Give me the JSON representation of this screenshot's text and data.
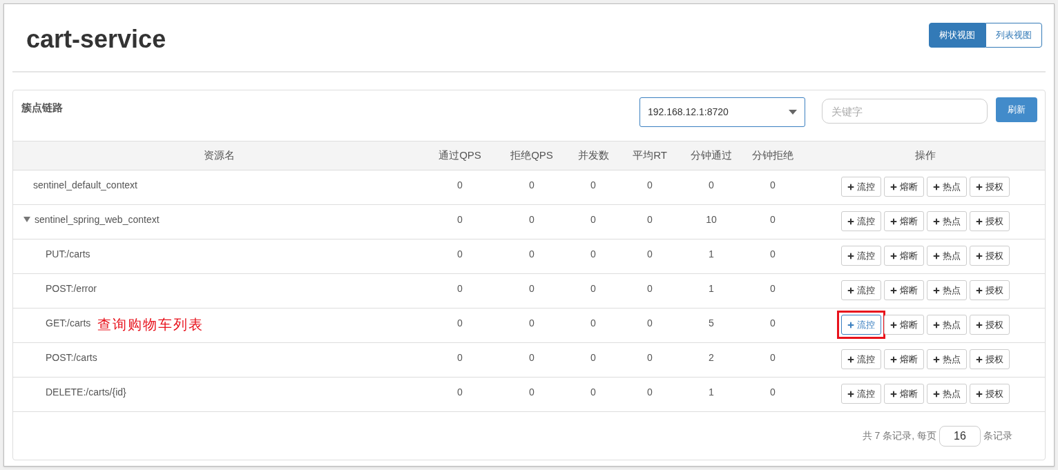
{
  "header": {
    "title": "cart-service",
    "view_toggle": [
      {
        "label": "树状视图",
        "selected": true
      },
      {
        "label": "列表视图",
        "selected": false
      }
    ]
  },
  "panel": {
    "title": "簇点链路",
    "machine_select": {
      "value": "192.168.12.1:8720"
    },
    "search": {
      "placeholder": "关键字"
    },
    "refresh_button": "刷新"
  },
  "table": {
    "columns": [
      "资源名",
      "通过QPS",
      "拒绝QPS",
      "并发数",
      "平均RT",
      "分钟通过",
      "分钟拒绝",
      "操作"
    ],
    "rows": [
      {
        "name": "sentinel_default_context",
        "values": [
          "0",
          "0",
          "0",
          "0",
          "0",
          "0"
        ],
        "actions": [
          {
            "label": "流控",
            "highlighted": false
          },
          {
            "label": "熔断",
            "highlighted": false
          },
          {
            "label": "热点",
            "highlighted": false
          },
          {
            "label": "授权",
            "highlighted": false
          }
        ]
      },
      {
        "name": "sentinel_spring_web_context",
        "expanded": true,
        "values": [
          "0",
          "0",
          "0",
          "0",
          "10",
          "0"
        ],
        "actions": [
          {
            "label": "流控",
            "highlighted": false
          },
          {
            "label": "熔断",
            "highlighted": false
          },
          {
            "label": "热点",
            "highlighted": false
          },
          {
            "label": "授权",
            "highlighted": false
          }
        ],
        "children": [
          {
            "name": "PUT:/carts",
            "values": [
              "0",
              "0",
              "0",
              "0",
              "1",
              "0"
            ],
            "actions": [
              {
                "label": "流控",
                "highlighted": false
              },
              {
                "label": "熔断",
                "highlighted": false
              },
              {
                "label": "热点",
                "highlighted": false
              },
              {
                "label": "授权",
                "highlighted": false
              }
            ]
          },
          {
            "name": "POST:/error",
            "values": [
              "0",
              "0",
              "0",
              "0",
              "1",
              "0"
            ],
            "actions": [
              {
                "label": "流控",
                "highlighted": false
              },
              {
                "label": "熔断",
                "highlighted": false
              },
              {
                "label": "热点",
                "highlighted": false
              },
              {
                "label": "授权",
                "highlighted": false
              }
            ]
          },
          {
            "name": "GET:/carts",
            "note": "查询购物车列表",
            "values": [
              "0",
              "0",
              "0",
              "0",
              "5",
              "0"
            ],
            "actions": [
              {
                "label": "流控",
                "highlighted": true
              },
              {
                "label": "熔断",
                "highlighted": false
              },
              {
                "label": "热点",
                "highlighted": false
              },
              {
                "label": "授权",
                "highlighted": false
              }
            ]
          },
          {
            "name": "POST:/carts",
            "values": [
              "0",
              "0",
              "0",
              "0",
              "2",
              "0"
            ],
            "actions": [
              {
                "label": "流控",
                "highlighted": false
              },
              {
                "label": "熔断",
                "highlighted": false
              },
              {
                "label": "热点",
                "highlighted": false
              },
              {
                "label": "授权",
                "highlighted": false
              }
            ]
          },
          {
            "name": "DELETE:/carts/{id}",
            "values": [
              "0",
              "0",
              "0",
              "0",
              "1",
              "0"
            ],
            "actions": [
              {
                "label": "流控",
                "highlighted": false
              },
              {
                "label": "熔断",
                "highlighted": false
              },
              {
                "label": "热点",
                "highlighted": false
              },
              {
                "label": "授权",
                "highlighted": false
              }
            ]
          }
        ]
      }
    ]
  },
  "pagination": {
    "total_text": "共 7 条记录, 每页",
    "page_size": "16",
    "suffix": "条记录"
  }
}
